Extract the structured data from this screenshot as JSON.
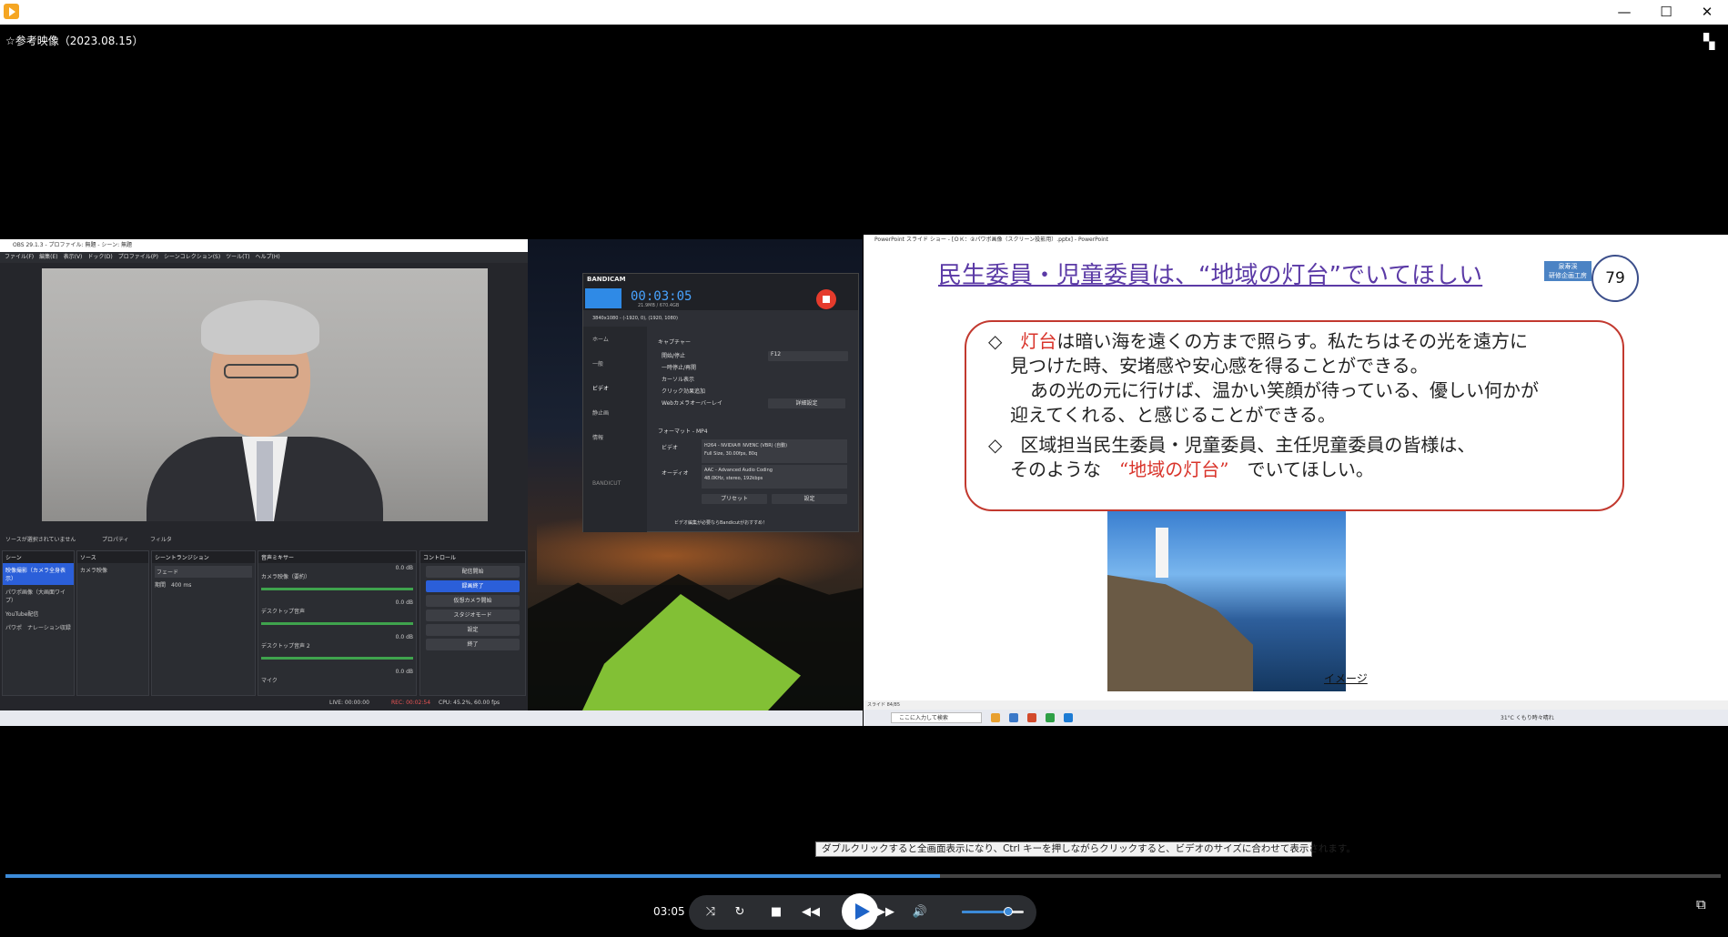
{
  "window": {
    "min_symbol": "—",
    "max_symbol": "☐",
    "close_symbol": "✕",
    "mode_icon": "compact-view-icon"
  },
  "video": {
    "title": "☆参考映像（2023.08.15）"
  },
  "obs": {
    "title": "OBS 29.1.3 - プロファイル: 無題 - シーン: 無題",
    "menu": "ファイル(F)　編集(E)　表示(V)　ドック(D)　プロファイル(P)　シーンコレクション(S)　ツール(T)　ヘルプ(H)",
    "no_source": "ソースが選択されていません",
    "properties": "プロパティ",
    "filters": "フィルタ",
    "scenes_header": "シーン",
    "scenes": [
      "映像撮影（カメラ全身表示）",
      "パワポ画像（大画面ワイプ）",
      "YouTube配信",
      "パワポ　ナレーション収録"
    ],
    "sources_header": "ソース",
    "source_item": "カメラ映像",
    "transition_header": "シーントランジション",
    "transition_value": "フェード",
    "duration_label": "期間",
    "duration_value": "400 ms",
    "mixer_header": "音声ミキサー",
    "mixer": [
      {
        "name": "カメラ映像（要約）",
        "db": "0.0 dB"
      },
      {
        "name": "デスクトップ音声",
        "db": "0.0 dB"
      },
      {
        "name": "デスクトップ音声 2",
        "db": "0.0 dB"
      },
      {
        "name": "マイク",
        "db": "0.0 dB"
      }
    ],
    "controls_header": "コントロール",
    "controls": [
      "配信開始",
      "録画終了",
      "仮想カメラ開始",
      "スタジオモード",
      "設定",
      "終了"
    ],
    "status_live": "LIVE: 00:00:00",
    "status_rec": "REC: 00:02:54",
    "status_cpu": "CPU: 45.2%, 60.00 fps"
  },
  "bandicam": {
    "logo": "BANDICAM",
    "timer": "00:03:05",
    "size": "21.9MB / 670.4GB",
    "resolution": "3840x1080 - (-1920, 0), (1920, 1080)",
    "sidebar": [
      "ホーム",
      "一般",
      "ビデオ",
      "静止画",
      "情報"
    ],
    "capture_header": "キャプチャー",
    "options": [
      "開始/停止",
      "一時停止/再開",
      "カーソル表示",
      "クリック効果追加",
      "Webカメラオーバーレイ"
    ],
    "hotkey1": "F12",
    "detail_button": "詳細設定",
    "format_header": "フォーマット - MP4",
    "video_label": "ビデオ",
    "video_value": "H264 - NVIDIA® NVENC (VBR) (自動)",
    "video_sub": "Full Size, 30.00fps, 80q",
    "audio_label": "オーディオ",
    "audio_value": "AAC - Advanced Audio Coding",
    "audio_sub": "48.0KHz, stereo, 192kbps",
    "preset_button": "プリセット",
    "settings_button": "設定",
    "bandicut": "BANDICUT",
    "footer": "ビデオ編集が必要ならBandicutがおすすめ！"
  },
  "ppt": {
    "window_title": "PowerPoint スライド ショー - [ＯＫ：②パワポ画像（スクリーン投影用）.pptx] - PowerPoint",
    "slide_title": "民生委員・児童委員は、“地域の灯台”でいてほしい",
    "badge": "泉寿渓\n研修企画工房",
    "slide_number": "79",
    "bullet1_mark": "◇",
    "bullet1_highlight": "灯台",
    "bullet1_l1": "は暗い海を遠くの方まで照らす。私たちはその光を遠方に",
    "bullet1_l2": "見つけた時、安堵感や安心感を得ることができる。",
    "bullet1_l3": "あの光の元に行けば、温かい笑顔が待っている、優しい何かが",
    "bullet1_l4": "迎えてくれる、と感じることができる。",
    "bullet2_mark": "◇",
    "bullet2_l1": "区域担当民生委員・児童委員、主任児童委員の皆様は、",
    "bullet2_l2a": "そのような",
    "bullet2_highlight": "“地域の灯台”",
    "bullet2_l2b": "でいてほしい。",
    "image_caption": "イメージ",
    "status": "スライド 84/85",
    "search_placeholder": "ここに入力して検索",
    "weather": "31°C くもり時々晴れ"
  },
  "tooltip": "ダブルクリックすると全画面表示になり、Ctrl キーを押しながらクリックすると、ビデオのサイズに合わせて表示されます。",
  "player": {
    "current_time": "03:05",
    "progress": 0.545,
    "volume": 0.75
  }
}
